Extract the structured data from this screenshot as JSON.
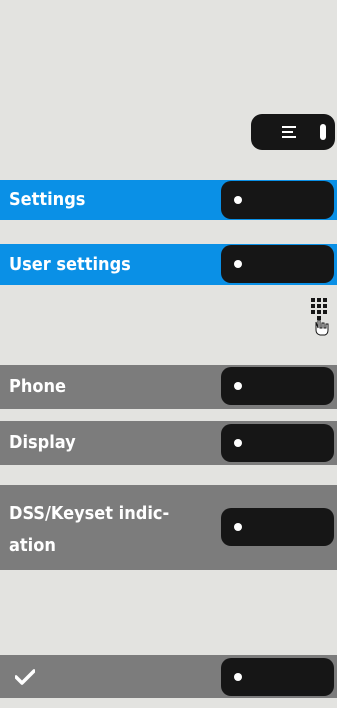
{
  "menu": [
    {
      "id": "settings",
      "label": "Settings",
      "style": "blue"
    },
    {
      "id": "user-settings",
      "label": "User settings",
      "style": "blue"
    }
  ],
  "options": [
    {
      "id": "phone",
      "label": "Phone"
    },
    {
      "id": "display",
      "label": "Display"
    },
    {
      "id": "dss-keyset-indication",
      "label_line1": "DSS/Keyset indic-",
      "label_line2": "ation"
    }
  ],
  "confirm": {
    "icon": "checkmark-icon",
    "glyph": "✔"
  },
  "icons": {
    "menu_key": "menu-lines-icon",
    "keypad": "keypad-icon"
  },
  "colors": {
    "blue_row": "#0a90e6",
    "gray_row": "#7c7c7c",
    "key": "#161616",
    "background": "#e3e3e0"
  }
}
